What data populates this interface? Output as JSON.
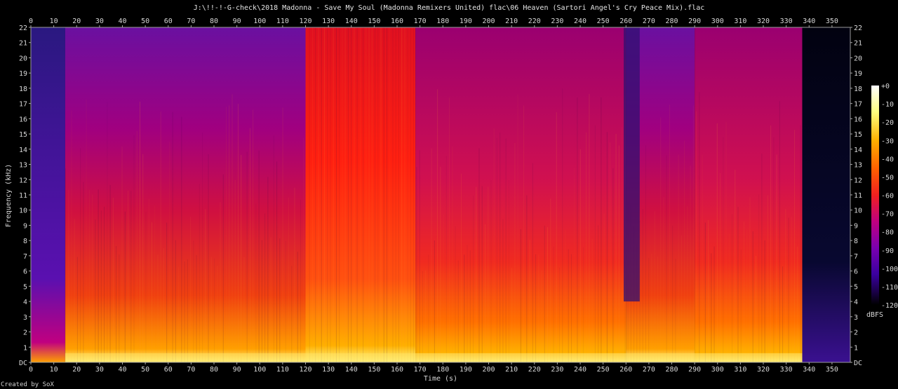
{
  "title": "J:\\!!-!-G-check\\2018 Madonna - Save My Soul (Madonna Remixers United) flac\\06 Heaven (Sartori Angel's Cry Peace Mix).flac",
  "credit": "Created by SoX",
  "chart_data": {
    "type": "heatmap",
    "xlabel": "Time (s)",
    "ylabel": "Frequency (kHz)",
    "colorbar_label": "dBFS",
    "xlim": [
      0,
      358
    ],
    "ylim": [
      0,
      22
    ],
    "x_ticks": [
      0,
      10,
      20,
      30,
      40,
      50,
      60,
      70,
      80,
      90,
      100,
      110,
      120,
      130,
      140,
      150,
      160,
      170,
      180,
      190,
      200,
      210,
      220,
      230,
      240,
      250,
      260,
      270,
      280,
      290,
      300,
      310,
      320,
      330,
      340,
      350
    ],
    "y_ticks": [
      "DC",
      "1",
      "2",
      "3",
      "4",
      "5",
      "6",
      "7",
      "8",
      "9",
      "10",
      "11",
      "12",
      "13",
      "14",
      "15",
      "16",
      "17",
      "18",
      "19",
      "20",
      "21",
      "22"
    ],
    "colorbar_ticks": [
      "+0",
      "-10",
      "-20",
      "-30",
      "-40",
      "-50",
      "-60",
      "-70",
      "-80",
      "-90",
      "-100",
      "-110",
      "-120"
    ],
    "colorbar_range": [
      -120,
      0
    ],
    "colormap": [
      "#000000",
      "#1a0048",
      "#3a00a0",
      "#7a00b0",
      "#c00080",
      "#f02020",
      "#ff6000",
      "#ffb000",
      "#ffff80",
      "#ffffff"
    ],
    "segments": [
      {
        "t0": 0,
        "t1": 15,
        "level": "quiet intro, low-frequency energy only"
      },
      {
        "t0": 15,
        "t1": 120,
        "level": "moderate, energy up to ~10 kHz"
      },
      {
        "t0": 120,
        "t1": 168,
        "level": "loud, energy up to 22 kHz"
      },
      {
        "t0": 168,
        "t1": 260,
        "level": "moderate-loud"
      },
      {
        "t0": 260,
        "t1": 290,
        "level": "breakdown"
      },
      {
        "t0": 290,
        "t1": 337,
        "level": "moderate-loud"
      },
      {
        "t0": 337,
        "t1": 358,
        "level": "fade out / silence"
      }
    ]
  }
}
